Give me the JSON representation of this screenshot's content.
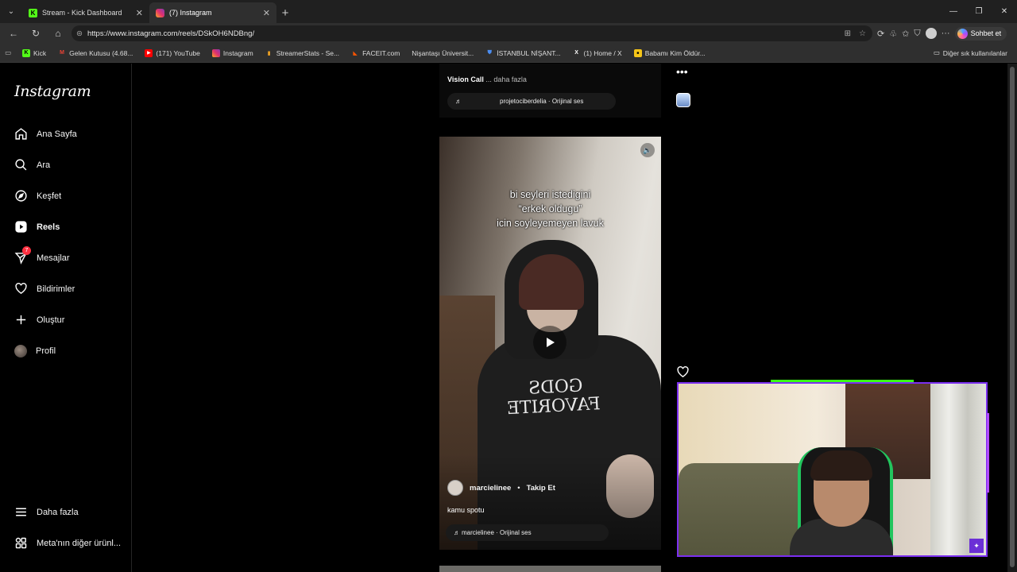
{
  "browser": {
    "tabs": [
      {
        "title": "Stream - Kick Dashboard",
        "active": false,
        "icon": "kick-icon"
      },
      {
        "title": "(7) Instagram",
        "active": true,
        "icon": "instagram-icon"
      }
    ],
    "url": "https://www.instagram.com/reels/DSkOH6NDBng/",
    "copilot_label": "Sohbet et",
    "bookmarks": [
      {
        "label": "Kick",
        "icon": "kick-icon",
        "color": "#53fc18"
      },
      {
        "label": "Gelen Kutusu (4.68...",
        "icon": "gmail-icon",
        "color": "#ea4335"
      },
      {
        "label": "(171) YouTube",
        "icon": "youtube-icon",
        "color": "#ff0000"
      },
      {
        "label": "Instagram",
        "icon": "instagram-icon",
        "color": "#e1306c"
      },
      {
        "label": "StreamerStats - Se...",
        "icon": "bars-icon",
        "color": "#f5a623"
      },
      {
        "label": "FACEIT.com",
        "icon": "faceit-icon",
        "color": "#ff5500"
      },
      {
        "label": "Nişantaşı Üniversit...",
        "icon": "blank-icon",
        "color": "#2f2f2f"
      },
      {
        "label": "İSTANBUL NİŞANT...",
        "icon": "shield-icon",
        "color": "#2f6fd6"
      },
      {
        "label": "(1) Home / X",
        "icon": "x-icon",
        "color": "#000000"
      },
      {
        "label": "Babamı Kim Öldür...",
        "icon": "imdb-icon",
        "color": "#f5c518"
      }
    ],
    "other_bookmarks": "Diğer sık kullanılanlar"
  },
  "sidebar": {
    "logo": "Instagram",
    "items": [
      {
        "label": "Ana Sayfa",
        "icon": "home-icon"
      },
      {
        "label": "Ara",
        "icon": "search-icon"
      },
      {
        "label": "Keşfet",
        "icon": "compass-icon"
      },
      {
        "label": "Reels",
        "icon": "reels-icon",
        "active": true
      },
      {
        "label": "Mesajlar",
        "icon": "messenger-icon",
        "badge": "7"
      },
      {
        "label": "Bildirimler",
        "icon": "heart-icon"
      },
      {
        "label": "Oluştur",
        "icon": "plus-icon"
      },
      {
        "label": "Profil",
        "icon": "avatar"
      }
    ],
    "bottom": [
      {
        "label": "Daha fazla",
        "icon": "menu-icon"
      },
      {
        "label": "Meta'nın diğer ürünl...",
        "icon": "meta-grid-icon"
      }
    ]
  },
  "prev_reel": {
    "caption_user": "Vision Call",
    "caption_more": "... daha fazla",
    "audio": "projetociberdelia · Orijinal ses"
  },
  "reel": {
    "overlay_lines": [
      "bi seyleri istedigini",
      "“erkek oldugu”",
      "icin soyleyemeyen lavuk"
    ],
    "hoodie_text": "GODS FAVORITE",
    "author": "marcielinee",
    "separator": "•",
    "follow": "Takip Et",
    "caption": "kamu spotu",
    "audio": "marcielinee · Orijinal ses"
  }
}
